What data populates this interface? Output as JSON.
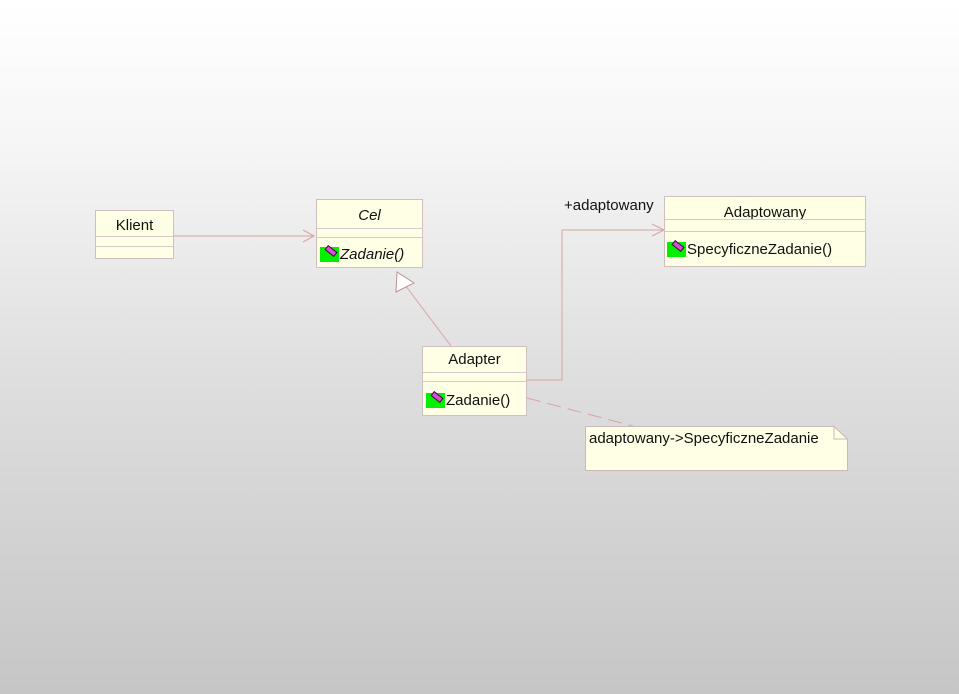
{
  "classes": {
    "klient": {
      "name": "Klient"
    },
    "cel": {
      "name": "Cel",
      "operation": "Zadanie()"
    },
    "adaptowany": {
      "name": "Adaptowany",
      "operation": "SpecyficzneZadanie()"
    },
    "adapter": {
      "name": "Adapter",
      "operation": "Zadanie()"
    }
  },
  "association": {
    "role_label": "+adaptowany"
  },
  "note": {
    "text": "adaptowany->SpecyficzneZadanie"
  },
  "icons": {
    "operation": "public-operation-icon"
  },
  "colors": {
    "class_fill": "#ffffe6",
    "class_border": "#d0bfbf",
    "connector": "#d9a3a3",
    "operation_icon_bg": "#00f000",
    "operation_icon_gem": "#d34fd3"
  }
}
